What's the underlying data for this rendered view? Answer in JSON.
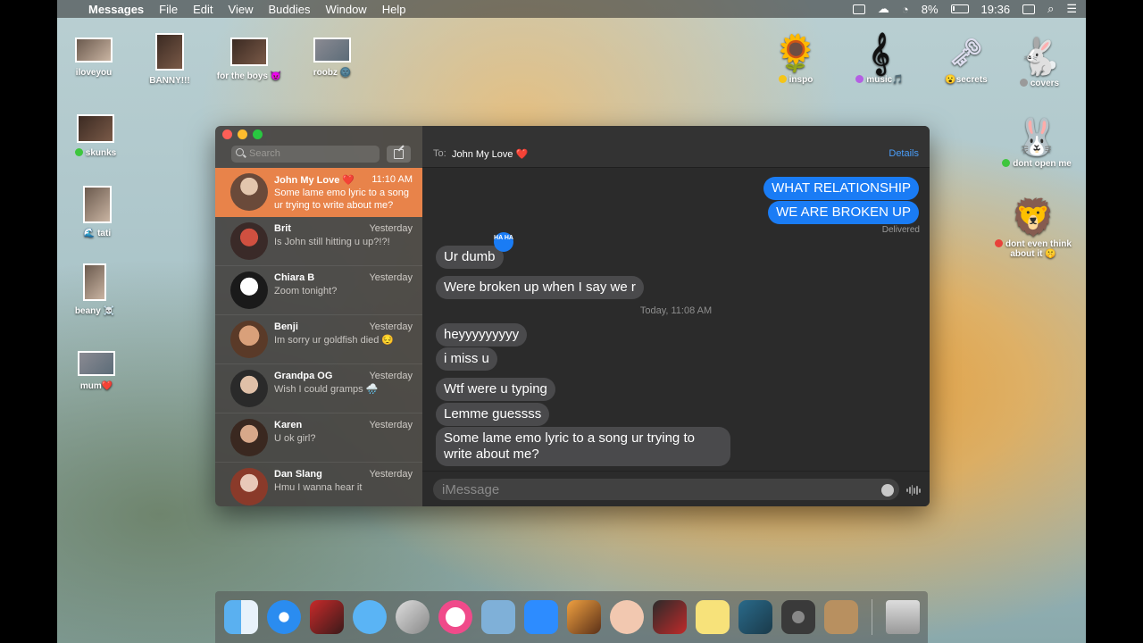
{
  "menubar": {
    "app_name": "Messages",
    "menus": [
      "File",
      "Edit",
      "View",
      "Buddies",
      "Window",
      "Help"
    ],
    "battery": "8%",
    "clock": "19:36"
  },
  "desktop": {
    "icons": [
      {
        "label": "iloveyou"
      },
      {
        "label": "BANNY!!!"
      },
      {
        "label": "for the boys 😈"
      },
      {
        "label": "roobz 🌚"
      },
      {
        "label": "skunks"
      },
      {
        "label": "🌊 tati"
      },
      {
        "label": "beany ☠️"
      },
      {
        "label": "mum❤️"
      },
      {
        "label": "inspo",
        "tag_color": "#f5c518"
      },
      {
        "label": "music🎵",
        "tag_color": "#b45fe3"
      },
      {
        "label": "😮secrets"
      },
      {
        "label": "covers",
        "tag_color": "#9a9a9a"
      },
      {
        "label": "dont open me",
        "tag_color": "#3ec63e"
      },
      {
        "label": "dont even think about it 🤫",
        "tag_color": "#e8413a"
      }
    ]
  },
  "sidebar": {
    "search_placeholder": "Search",
    "conversations": [
      {
        "name": "John My Love ❤️",
        "time": "11:10 AM",
        "preview": "Some lame emo lyric to a song ur trying to write about me?"
      },
      {
        "name": "Brit",
        "time": "Yesterday",
        "preview": "Is John still hitting u up?!?!"
      },
      {
        "name": "Chiara B",
        "time": "Yesterday",
        "preview": "Zoom tonight?"
      },
      {
        "name": "Benji",
        "time": "Yesterday",
        "preview": "Im sorry ur goldfish died 😔"
      },
      {
        "name": "Grandpa OG",
        "time": "Yesterday",
        "preview": "Wish I could gramps 🌧️"
      },
      {
        "name": "Karen",
        "time": "Yesterday",
        "preview": "U ok girl?"
      },
      {
        "name": "Dan Slang",
        "time": "Yesterday",
        "preview": "Hmu I wanna hear it"
      }
    ]
  },
  "chat": {
    "to_label": "To:",
    "to_name": "John My Love ❤️",
    "details_label": "Details",
    "delivered": "Delivered",
    "timestamp": "Today, 11:08 AM",
    "tapback": "HA HA",
    "messages": [
      {
        "dir": "out",
        "text": "WHAT RELATIONSHIP"
      },
      {
        "dir": "out",
        "text": "WE ARE BROKEN UP"
      },
      {
        "dir": "in",
        "text": "Ur dumb"
      },
      {
        "dir": "in",
        "text": "Were broken up when I say we r"
      },
      {
        "dir": "in",
        "text": "heyyyyyyyyy"
      },
      {
        "dir": "in",
        "text": "i miss u"
      },
      {
        "dir": "in",
        "text": "Wtf were u typing"
      },
      {
        "dir": "in",
        "text": "Lemme guessss"
      },
      {
        "dir": "in",
        "text": "Some lame emo lyric to a song ur trying to write about me?"
      }
    ],
    "input_placeholder": "iMessage"
  },
  "dock": {
    "apps": [
      "finder-icon",
      "safari-icon",
      "photo-booth-icon",
      "messages-icon",
      "app-icon",
      "itunes-icon",
      "app-icon",
      "zoom-icon",
      "garageband-icon",
      "app-icon",
      "app-icon",
      "stickies-icon",
      "preview-icon",
      "system-preferences-icon",
      "contacts-icon",
      "trash-icon"
    ]
  },
  "colors": {
    "accent": "#e8834a",
    "bubble_out": "#1a7cf5",
    "bubble_in": "#4a4a4c",
    "link": "#4a9df8"
  }
}
